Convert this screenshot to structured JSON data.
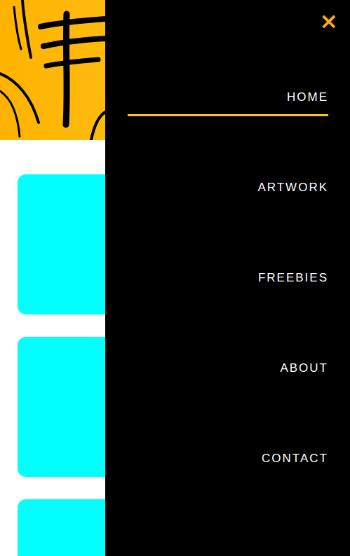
{
  "menu": {
    "close": "×",
    "items": [
      {
        "label": "HOME",
        "selected": true
      },
      {
        "label": "ARTWORK",
        "selected": false
      },
      {
        "label": "FREEBIES",
        "selected": false
      },
      {
        "label": "ABOUT",
        "selected": false
      },
      {
        "label": "CONTACT",
        "selected": false
      }
    ]
  },
  "cards": [
    {},
    {},
    {}
  ]
}
